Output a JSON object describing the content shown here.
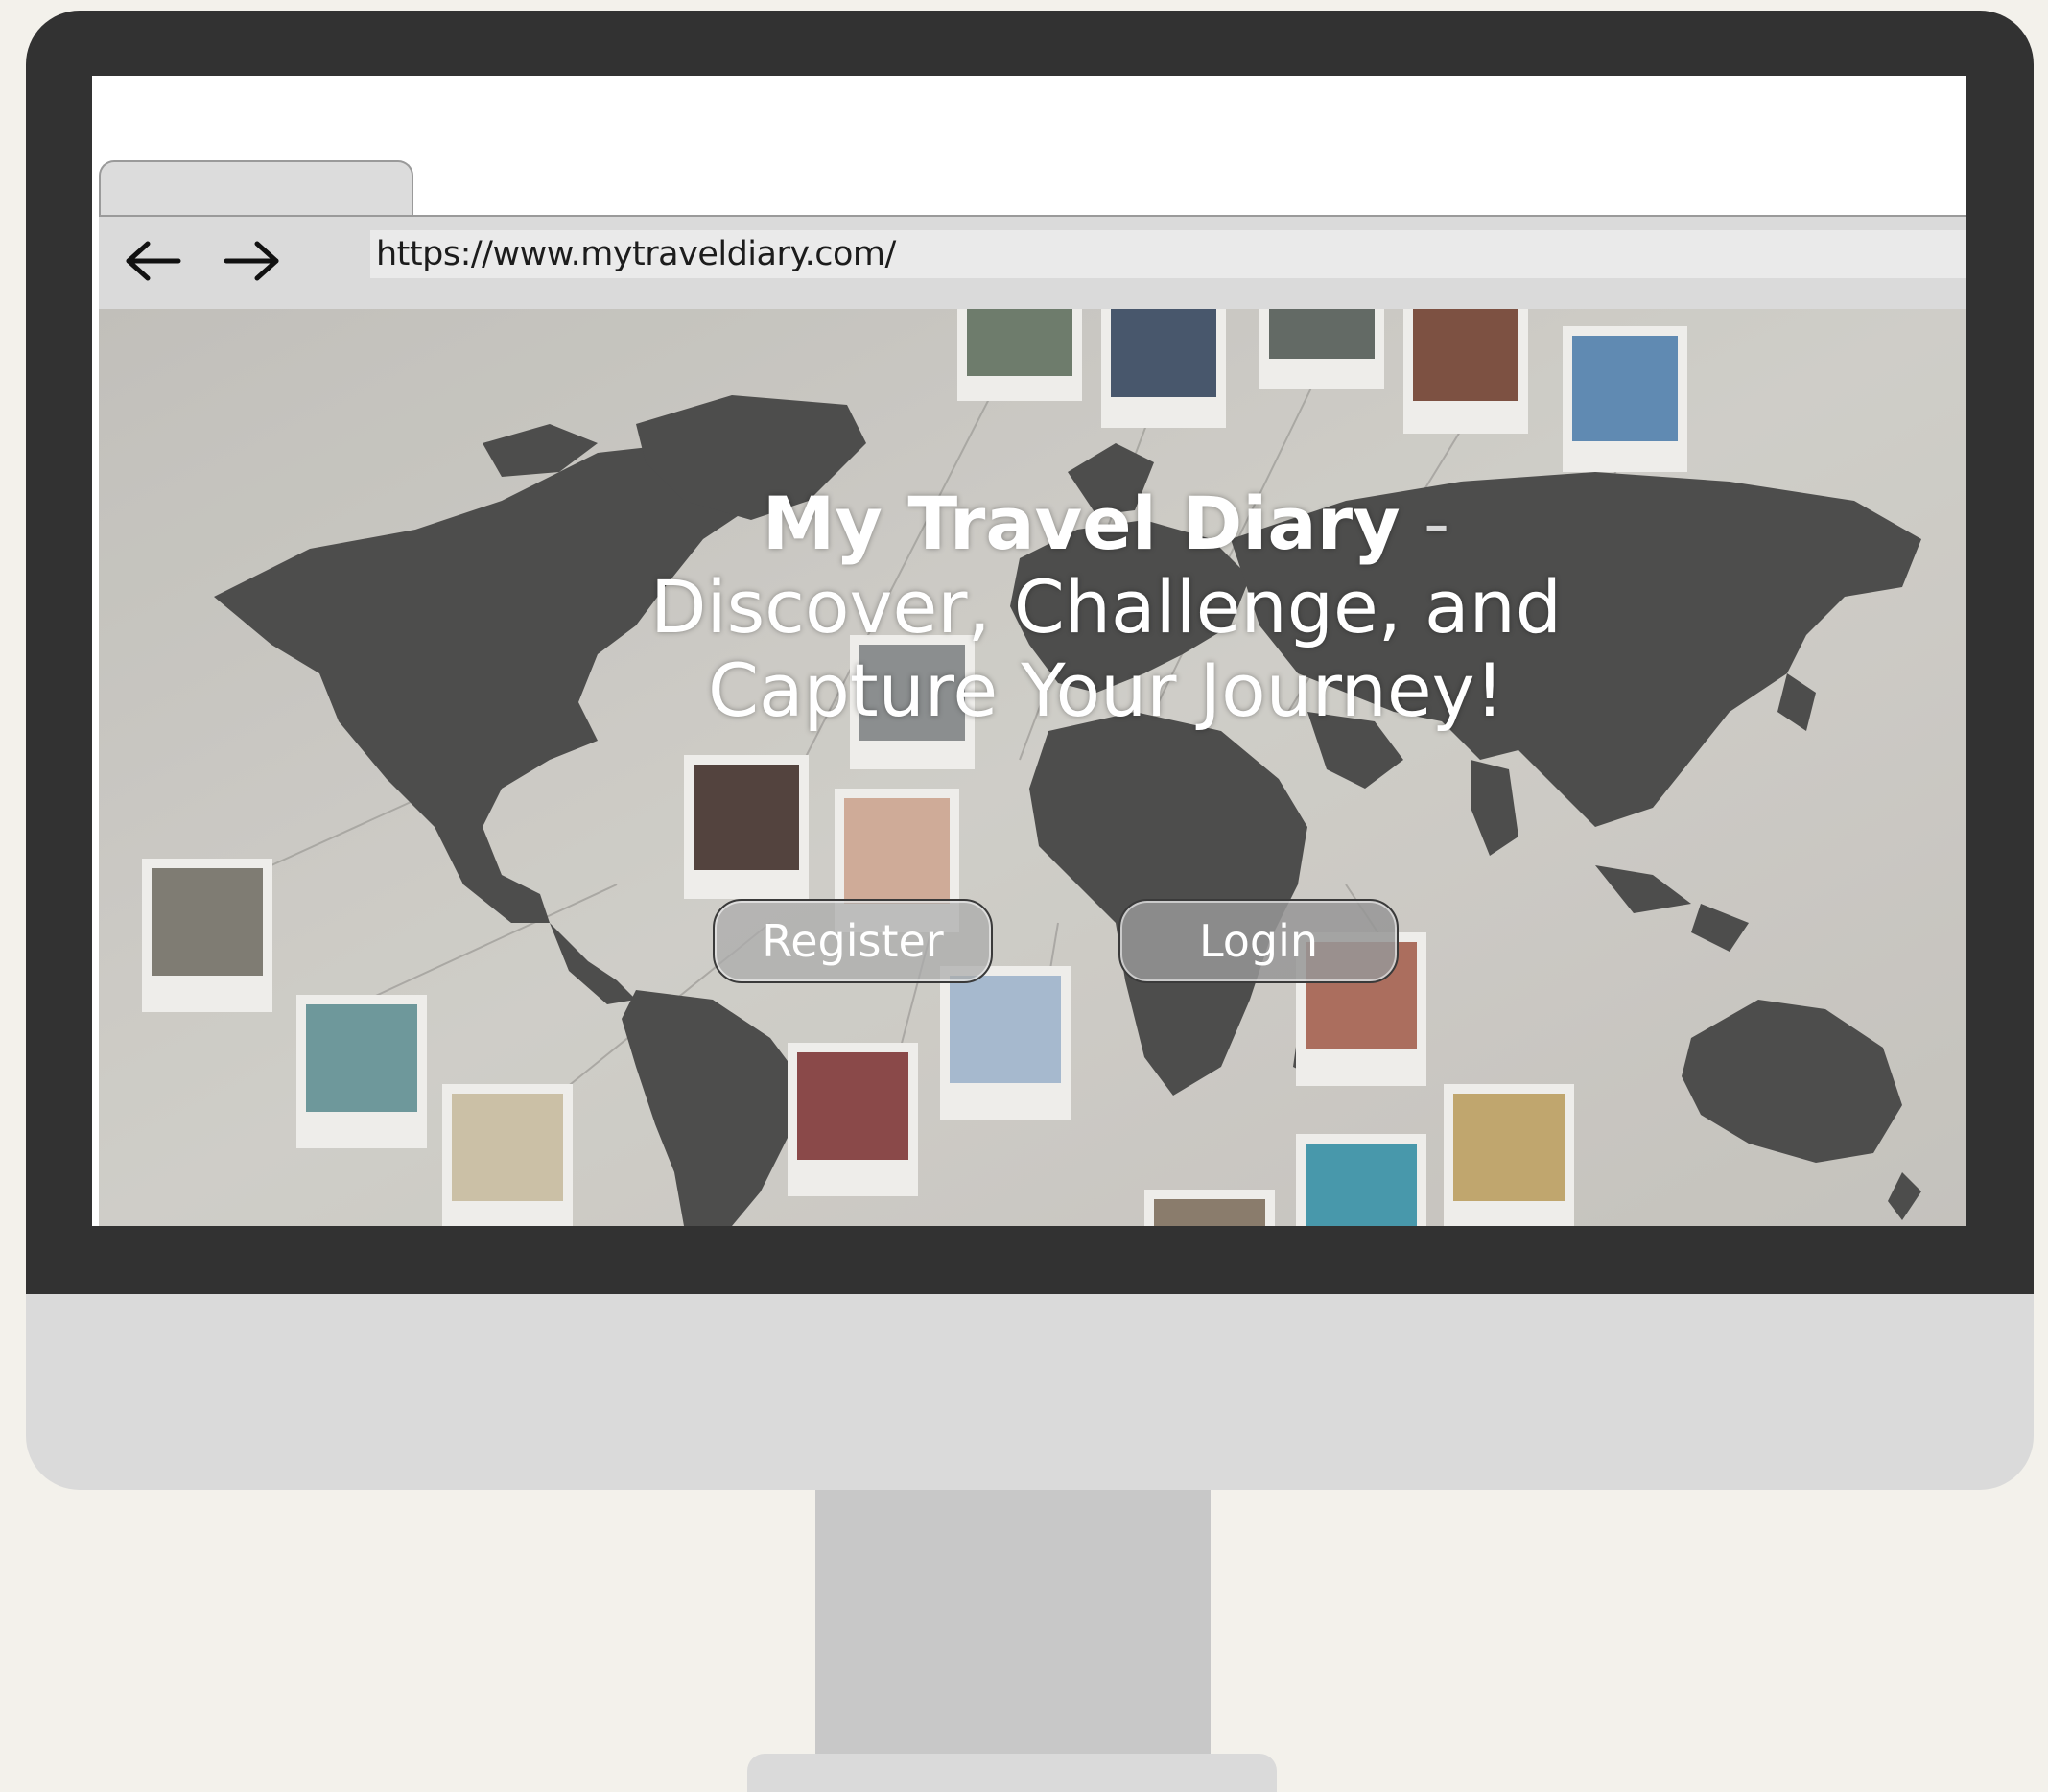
{
  "browser": {
    "back_icon": "arrow-left-icon",
    "forward_icon": "arrow-right-icon",
    "url": "https://www.mytraveldiary.com/"
  },
  "hero": {
    "title_strong": "My Travel Diary",
    "title_dash": " - ",
    "title_rest": "Discover, Challenge, and Capture Your Journey!",
    "background": "world-map-wall-with-polaroid-photos"
  },
  "actions": {
    "register_label": "Register",
    "login_label": "Login"
  },
  "colors": {
    "bezel": "#323232",
    "chin": "#dadada",
    "stand": "#c8c8c8",
    "backdrop": "#f3f1eb"
  }
}
